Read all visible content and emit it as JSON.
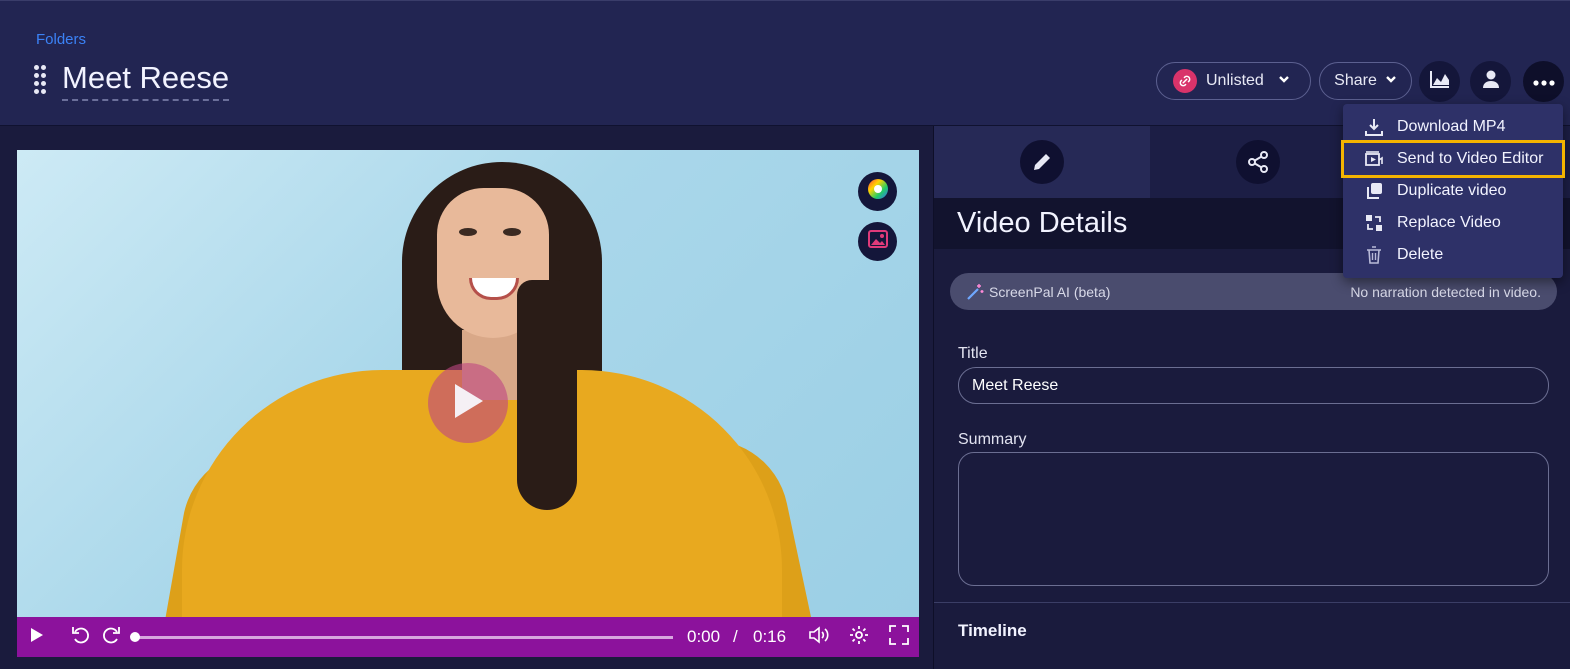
{
  "header": {
    "breadcrumb": "Folders",
    "title": "Meet Reese",
    "visibility_label": "Unlisted",
    "share_label": "Share"
  },
  "menu": {
    "items": [
      {
        "label": "Download MP4",
        "icon": "download-icon"
      },
      {
        "label": "Send to Video Editor",
        "icon": "video-editor-icon",
        "highlighted": true
      },
      {
        "label": "Duplicate video",
        "icon": "duplicate-icon"
      },
      {
        "label": "Replace Video",
        "icon": "replace-icon"
      },
      {
        "label": "Delete",
        "icon": "trash-icon"
      }
    ]
  },
  "player": {
    "current_time": "0:00",
    "separator": "/",
    "duration": "0:16",
    "progress": 0
  },
  "panel": {
    "section_title": "Video Details",
    "ai_label": "ScreenPal AI (beta)",
    "ai_status": "No narration detected in video.",
    "title_label": "Title",
    "title_value": "Meet Reese",
    "summary_label": "Summary",
    "summary_value": "",
    "timeline_label": "Timeline"
  },
  "colors": {
    "background": "#1a1b3d",
    "header": "#222552",
    "player_bar": "#8c129c",
    "menu_highlight": "#f4b400",
    "link_badge": "#d9336a",
    "breadcrumb": "#3b82f6"
  }
}
